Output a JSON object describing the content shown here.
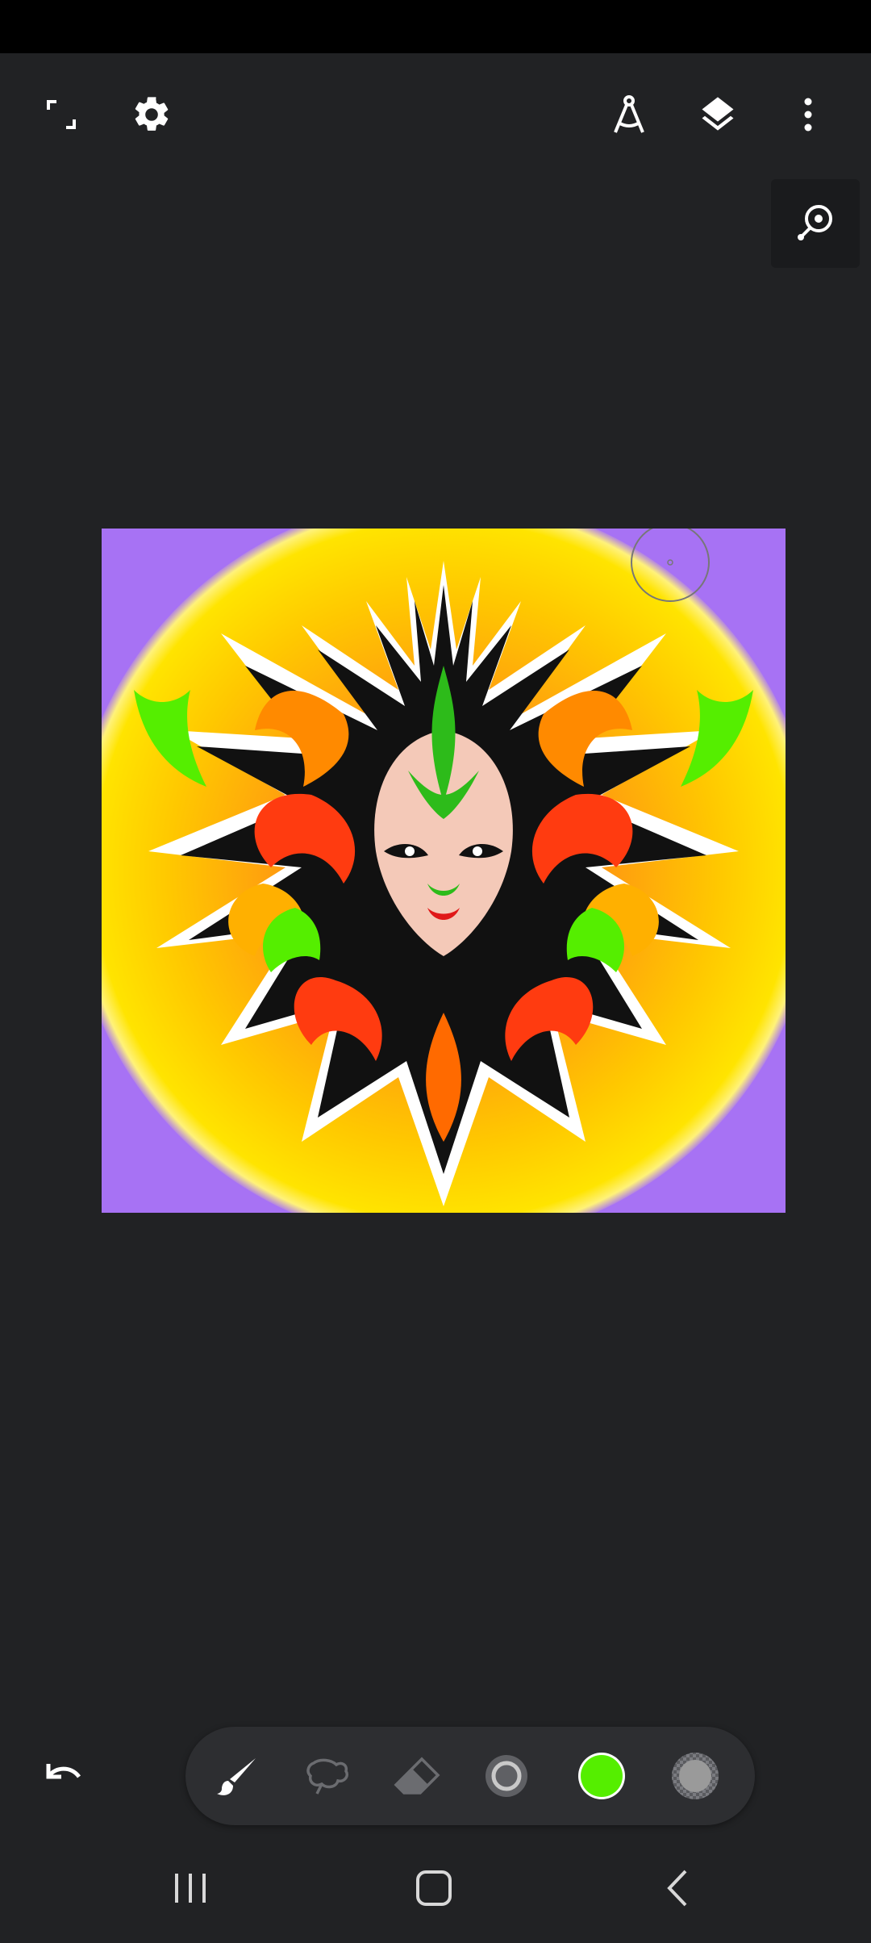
{
  "app": {
    "status_bar": "",
    "colors": {
      "background": "#212224",
      "canvas_background": "#a772f4",
      "current_color": "#55ee00",
      "secondary_color": "#9a9a9a"
    }
  },
  "top_bar": {
    "left_icons": [
      "fullscreen-icon",
      "settings-icon"
    ],
    "right_icons": [
      "ruler-compass-icon",
      "layers-icon",
      "more-vert-icon"
    ]
  },
  "zoom_tool": {
    "icon": "zoom-search-icon"
  },
  "bottom_toolbar": {
    "tools": [
      "brush-icon",
      "lasso-icon",
      "eraser-icon",
      "brush-size-icon",
      "color-swatch-icon",
      "opacity-icon"
    ],
    "active_tool": "brush-icon"
  },
  "undo": {
    "icon": "undo-icon"
  },
  "system_nav": [
    "recents-icon",
    "home-icon",
    "back-icon"
  ]
}
